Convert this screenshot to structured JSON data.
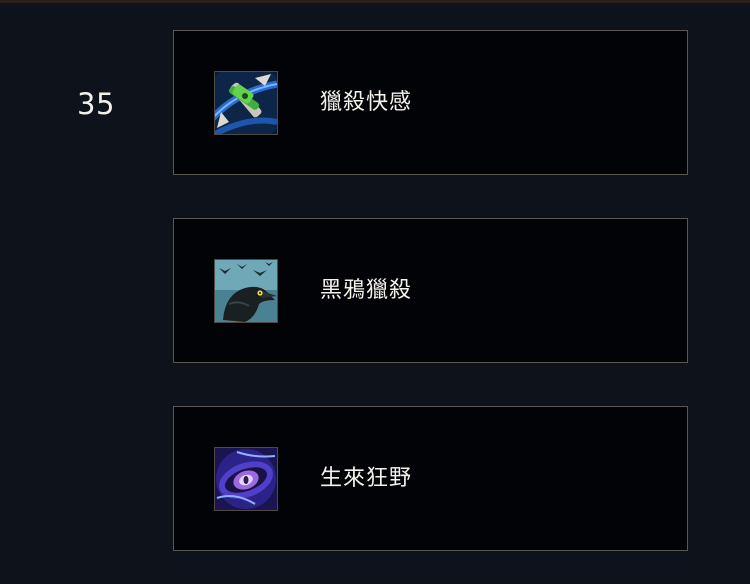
{
  "tier": {
    "level": "35"
  },
  "runes": [
    {
      "name": "獵殺快感",
      "icon": "crossbow-rune-icon"
    },
    {
      "name": "黑鴉獵殺",
      "icon": "raven-rune-icon"
    },
    {
      "name": "生來狂野",
      "icon": "violet-eye-rune-icon"
    }
  ]
}
